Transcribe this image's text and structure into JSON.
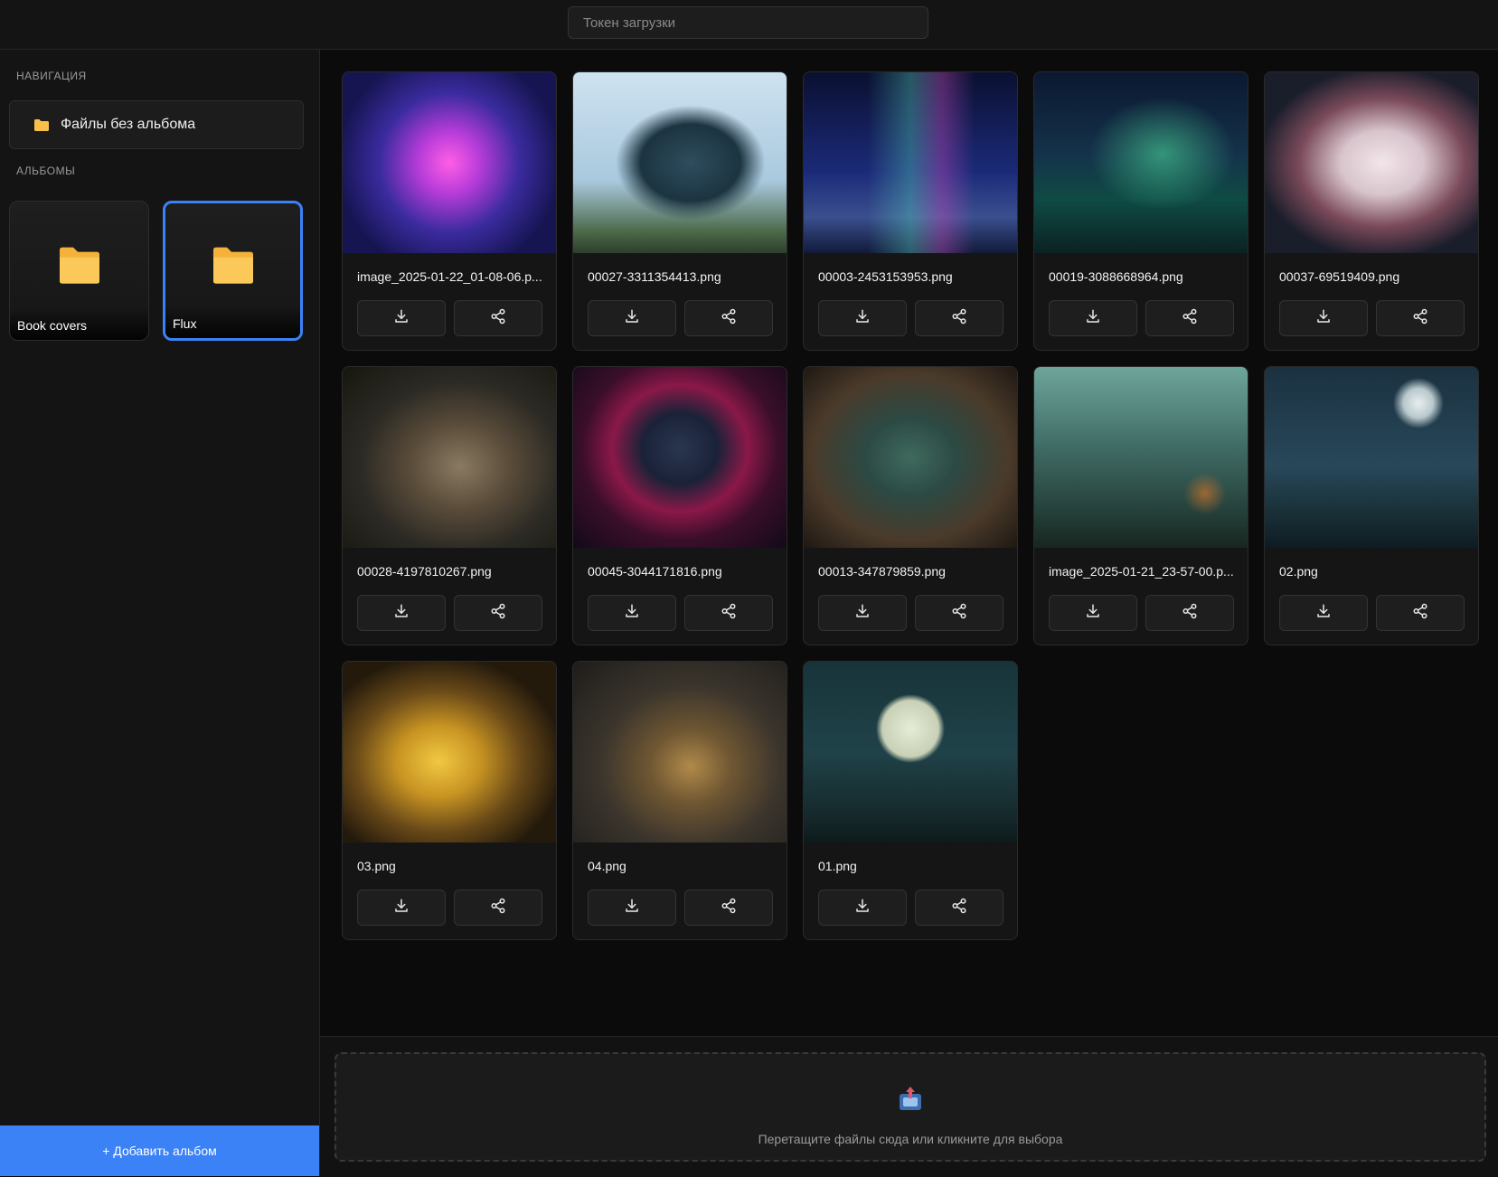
{
  "topbar": {
    "token_placeholder": "Токен загрузки"
  },
  "sidebar": {
    "nav_title": "Навигация",
    "nav_items": [
      {
        "label": "Файлы без альбома",
        "icon": "folder-icon"
      }
    ],
    "albums_title": "Альбомы",
    "albums": [
      {
        "label": "Book covers",
        "icon": "folder-icon",
        "active": false
      },
      {
        "label": "Flux",
        "icon": "folder-icon",
        "active": true
      }
    ],
    "add_album_label": "+ Добавить альбом"
  },
  "gallery": {
    "files": [
      {
        "name": "image_2025-01-22_01-08-06.p..."
      },
      {
        "name": "00027-3311354413.png"
      },
      {
        "name": "00003-2453153953.png"
      },
      {
        "name": "00019-3088668964.png"
      },
      {
        "name": "00037-69519409.png"
      },
      {
        "name": "00028-4197810267.png"
      },
      {
        "name": "00045-3044171816.png"
      },
      {
        "name": "00013-347879859.png"
      },
      {
        "name": "image_2025-01-21_23-57-00.p..."
      },
      {
        "name": "02.png"
      },
      {
        "name": "03.png"
      },
      {
        "name": "04.png"
      },
      {
        "name": "01.png"
      }
    ],
    "download_icon": "download-icon",
    "share_icon": "share-icon"
  },
  "upload": {
    "icon": "upload-tray-icon",
    "text": "Перетащите файлы сюда или кликните для выбора"
  },
  "colors": {
    "accent": "#3b82f6",
    "folder": "#f8c04a",
    "background": "#0b0b0b"
  }
}
